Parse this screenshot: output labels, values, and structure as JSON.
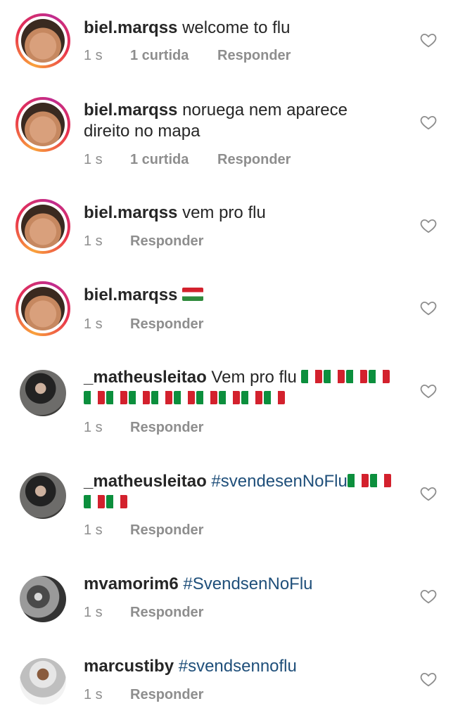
{
  "comments": [
    {
      "user": "biel.marqss",
      "text": "welcome to flu",
      "time": "1 s",
      "likes": "1 curtida",
      "reply": "Responder"
    },
    {
      "user": "biel.marqss",
      "text": "noruega nem aparece direito no mapa",
      "time": "1 s",
      "likes": "1 curtida",
      "reply": "Responder"
    },
    {
      "user": "biel.marqss",
      "text": "vem pro flu",
      "time": "1 s",
      "reply": "Responder"
    },
    {
      "user": "biel.marqss",
      "text": "",
      "flag_icon": "hungary-flag-emoji",
      "time": "1 s",
      "reply": "Responder"
    },
    {
      "user": "_matheusleitao",
      "text": "Vem pro flu",
      "flag_icon": "italy-flag-emoji",
      "flag_count": 13,
      "time": "1 s",
      "reply": "Responder"
    },
    {
      "user": "_matheusleitao",
      "text": "#svendesenNoFlu",
      "flag_icon": "italy-flag-emoji",
      "flag_count": 4,
      "time": "1 s",
      "reply": "Responder"
    },
    {
      "user": "mvamorim6",
      "text": "#SvendsenNoFlu",
      "time": "1 s",
      "reply": "Responder"
    },
    {
      "user": "marcustiby",
      "text": "#svendsennoflu",
      "time": "1 s",
      "reply": "Responder"
    }
  ],
  "colors": {
    "text": "#262626",
    "meta": "#8e8e8e",
    "hashtag": "#1f4f7a"
  },
  "icons": {
    "like": "heart-outline-icon"
  }
}
